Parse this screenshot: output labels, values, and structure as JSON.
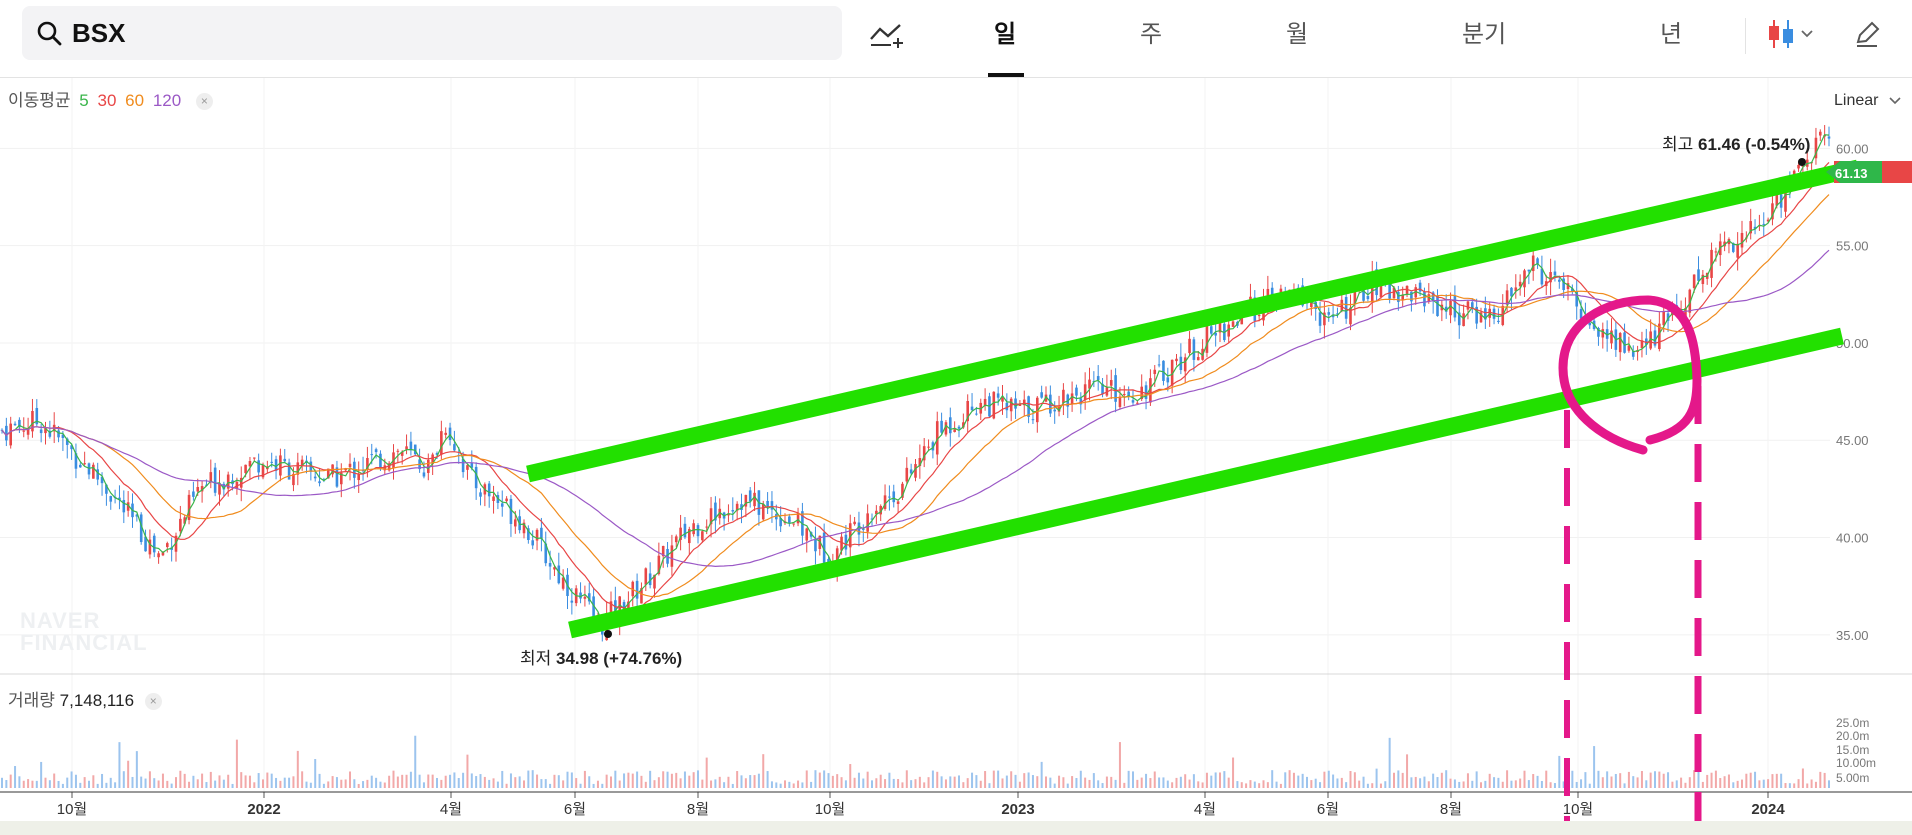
{
  "search": {
    "value": "BSX"
  },
  "toolbar": {
    "indicator_icon": "chart-add-icon",
    "candle_icon": "candlestick-icon",
    "draw_icon": "pencil-icon"
  },
  "tabs": [
    {
      "label": "일",
      "active": true
    },
    {
      "label": "주",
      "active": false
    },
    {
      "label": "월",
      "active": false
    },
    {
      "label": "분기",
      "active": false
    },
    {
      "label": "년",
      "active": false
    }
  ],
  "indicators": {
    "ma_label": "이동평균",
    "ma_periods": [
      {
        "label": "5",
        "color": "#39b54a"
      },
      {
        "label": "30",
        "color": "#e84646"
      },
      {
        "label": "60",
        "color": "#f08c1e"
      },
      {
        "label": "120",
        "color": "#9b59c6"
      }
    ],
    "volume_label": "거래량",
    "volume_value": "7,148,116"
  },
  "scale_mode": "Linear",
  "watermark": [
    "NAVER",
    "FINANCIAL"
  ],
  "annotations": {
    "high_prefix": "최고",
    "high_value": "61.46 (-0.54%)",
    "low_prefix": "최저",
    "low_value": "34.98 (+74.76%)"
  },
  "last_price_label": "61.13",
  "colors": {
    "up": "#e84646",
    "down": "#3a8de0",
    "channel": "#22e000",
    "markup": "#e4188a"
  },
  "chart_data": {
    "type": "candlestick",
    "price_axis": {
      "ticks": [
        "60.00",
        "55.00",
        "50.00",
        "45.00",
        "40.00",
        "35.00"
      ],
      "ylim": [
        33.5,
        63.0
      ]
    },
    "volume_axis": {
      "ticks": [
        "25.0m",
        "20.0m",
        "15.0m",
        "10.00m",
        "5.00m"
      ]
    },
    "x_ticks": [
      "10월",
      "2022",
      "4월",
      "6월",
      "8월",
      "10월",
      "2023",
      "4월",
      "6월",
      "8월",
      "10월",
      "2024"
    ],
    "price_path": [
      {
        "t": 0,
        "v": 45.5
      },
      {
        "t": 40,
        "v": 46.0
      },
      {
        "t": 100,
        "v": 43.0
      },
      {
        "t": 160,
        "v": 39.0
      },
      {
        "t": 200,
        "v": 42.5
      },
      {
        "t": 260,
        "v": 44.0
      },
      {
        "t": 330,
        "v": 43.0
      },
      {
        "t": 400,
        "v": 44.5
      },
      {
        "t": 430,
        "v": 43.5
      },
      {
        "t": 445,
        "v": 46.0
      },
      {
        "t": 470,
        "v": 43.0
      },
      {
        "t": 520,
        "v": 41.0
      },
      {
        "t": 560,
        "v": 38.0
      },
      {
        "t": 600,
        "v": 35.5
      },
      {
        "t": 640,
        "v": 37.5
      },
      {
        "t": 690,
        "v": 40.5
      },
      {
        "t": 740,
        "v": 42.0
      },
      {
        "t": 790,
        "v": 41.0
      },
      {
        "t": 830,
        "v": 39.0
      },
      {
        "t": 870,
        "v": 41.5
      },
      {
        "t": 900,
        "v": 42.5
      },
      {
        "t": 940,
        "v": 45.5
      },
      {
        "t": 980,
        "v": 47.0
      },
      {
        "t": 1020,
        "v": 46.5
      },
      {
        "t": 1080,
        "v": 47.5
      },
      {
        "t": 1140,
        "v": 47.5
      },
      {
        "t": 1200,
        "v": 50.0
      },
      {
        "t": 1260,
        "v": 52.0
      },
      {
        "t": 1300,
        "v": 52.5
      },
      {
        "t": 1330,
        "v": 51.0
      },
      {
        "t": 1370,
        "v": 53.0
      },
      {
        "t": 1420,
        "v": 52.5
      },
      {
        "t": 1460,
        "v": 51.5
      },
      {
        "t": 1500,
        "v": 51.5
      },
      {
        "t": 1530,
        "v": 54.0
      },
      {
        "t": 1560,
        "v": 53.0
      },
      {
        "t": 1600,
        "v": 50.5
      },
      {
        "t": 1640,
        "v": 49.5
      },
      {
        "t": 1680,
        "v": 52.0
      },
      {
        "t": 1720,
        "v": 55.0
      },
      {
        "t": 1760,
        "v": 56.0
      },
      {
        "t": 1800,
        "v": 59.0
      },
      {
        "t": 1830,
        "v": 61.0
      }
    ]
  }
}
